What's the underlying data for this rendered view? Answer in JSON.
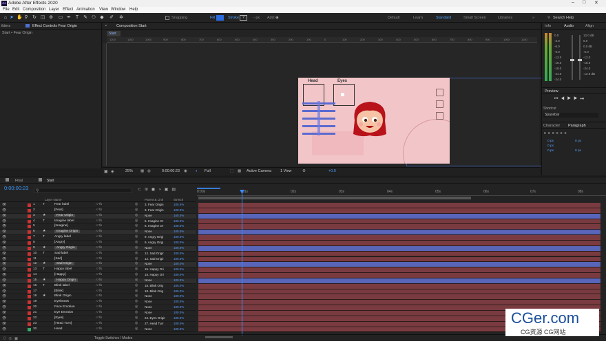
{
  "app": {
    "title": "Adobe After Effects 2020",
    "logo_text": "Ae"
  },
  "menu": [
    "File",
    "Edit",
    "Composition",
    "Layer",
    "Effect",
    "Animation",
    "View",
    "Window",
    "Help"
  ],
  "toolbar": {
    "snapping": "Snapping",
    "fill": "Fill",
    "stroke": "Stroke",
    "px": "- px",
    "add": "Add:"
  },
  "workspaces": [
    "Default",
    "Learn",
    "Standard",
    "Small Screen",
    "Libraries"
  ],
  "search_help": "Search Help",
  "left_panel": {
    "tabs": [
      "ilders",
      "Effect Controls Fear Origin"
    ],
    "breadcrumb": "Start • Fear Origin"
  },
  "comp_panel": {
    "tab": "Composition Start",
    "comp_tab": "Start",
    "ruler": [
      "1200",
      "1100",
      "1000",
      "900",
      "800",
      "700",
      "600",
      "500",
      "400",
      "300",
      "200",
      "100",
      "0",
      "100",
      "200",
      "300",
      "400",
      "500",
      "600",
      "700",
      "800",
      "900",
      "1000",
      "1100",
      "1200",
      "1300"
    ]
  },
  "viewer_bar": {
    "zoom": "25%",
    "time": "0:00:00:23",
    "res": "Full",
    "camera": "Active Camera",
    "view": "1 View",
    "offset": "+0.0"
  },
  "comp_art": {
    "head_label": "Head",
    "eyes_label": "Eyes"
  },
  "right_panel": {
    "tabs": [
      "Info",
      "Audio",
      "Align"
    ],
    "audio_levels": [
      "0.0",
      "-3.0",
      "-6.0",
      "-9.0",
      "-12.0",
      "-15.0",
      "-18.0",
      "-21.0",
      "-24.0"
    ],
    "audio_right": [
      "12.0 dB",
      "0.0 dB",
      "-12.0 dB"
    ],
    "preview": "Preview",
    "shortcut": "Shortcut",
    "shortcut_value": "Spacebar",
    "tabs2": [
      "Character",
      "Paragraph"
    ],
    "para_values": [
      "0 px",
      "0 px",
      "0 px",
      "0 px",
      "0 px"
    ]
  },
  "timeline": {
    "tabs": [
      "Final",
      "Start"
    ],
    "timecode": "0:00:00:23",
    "search_placeholder": "",
    "cols": {
      "layer_name": "Layer Name",
      "parent": "Parent & Link",
      "stretch": "Stretch"
    },
    "ticks": [
      "0:00s",
      "01s",
      "02s",
      "03s",
      "04s",
      "05s",
      "06s",
      "07s",
      "08s"
    ],
    "bottom": "Toggle Switches / Modes",
    "layers": [
      {
        "n": "1",
        "type": "T",
        "name": "Fear label",
        "parent": "3. Fear Origin",
        "stretch": "100.0%",
        "sel": false,
        "lbl": "#c33"
      },
      {
        "n": "2",
        "type": "",
        "name": "[Fear]",
        "parent": "3. Fear Origin",
        "stretch": "100.0%",
        "sel": false,
        "lbl": "#c33"
      },
      {
        "n": "3",
        "type": "★",
        "name": "Fear Origin",
        "parent": "None",
        "stretch": "100.0%",
        "sel": true,
        "lbl": "#c33"
      },
      {
        "n": "4",
        "type": "T",
        "name": "Imagine label",
        "parent": "6. Imagine Or",
        "stretch": "100.0%",
        "sel": false,
        "lbl": "#c33"
      },
      {
        "n": "5",
        "type": "",
        "name": "[Imagine]",
        "parent": "6. Imagine Or",
        "stretch": "100.0%",
        "sel": false,
        "lbl": "#c33"
      },
      {
        "n": "6",
        "type": "★",
        "name": "Imagine Origin",
        "parent": "None",
        "stretch": "100.0%",
        "sel": true,
        "lbl": "#c33"
      },
      {
        "n": "7",
        "type": "T",
        "name": "Angry label",
        "parent": "9. Angry Origi",
        "stretch": "100.0%",
        "sel": false,
        "lbl": "#c33"
      },
      {
        "n": "8",
        "type": "",
        "name": "[Angry]",
        "parent": "9. Angry Origi",
        "stretch": "100.0%",
        "sel": false,
        "lbl": "#c33"
      },
      {
        "n": "9",
        "type": "★",
        "name": "Angry Origin",
        "parent": "None",
        "stretch": "100.0%",
        "sel": true,
        "lbl": "#c33"
      },
      {
        "n": "10",
        "type": "T",
        "name": "Sad label",
        "parent": "12. Sad Origir",
        "stretch": "100.0%",
        "sel": false,
        "lbl": "#c33"
      },
      {
        "n": "11",
        "type": "",
        "name": "[Sad]",
        "parent": "12. Sad Origir",
        "stretch": "100.0%",
        "sel": false,
        "lbl": "#c33"
      },
      {
        "n": "12",
        "type": "★",
        "name": "Sad Origin",
        "parent": "None",
        "stretch": "100.0%",
        "sel": true,
        "lbl": "#c33"
      },
      {
        "n": "13",
        "type": "T",
        "name": "Happy label",
        "parent": "15. Happy Ori",
        "stretch": "100.0%",
        "sel": false,
        "lbl": "#c33"
      },
      {
        "n": "14",
        "type": "",
        "name": "[Happy]",
        "parent": "15. Happy Ori",
        "stretch": "100.0%",
        "sel": false,
        "lbl": "#c33"
      },
      {
        "n": "15",
        "type": "★",
        "name": "Happy Origin",
        "parent": "None",
        "stretch": "100.0%",
        "sel": true,
        "lbl": "#c33"
      },
      {
        "n": "16",
        "type": "T",
        "name": "Blink label",
        "parent": "18. Blink Orig",
        "stretch": "100.0%",
        "sel": false,
        "lbl": "#c33"
      },
      {
        "n": "17",
        "type": "",
        "name": "[Blink]",
        "parent": "18. Blink Orig",
        "stretch": "100.0%",
        "sel": false,
        "lbl": "#c33"
      },
      {
        "n": "18",
        "type": "★",
        "name": "Blink Origin",
        "parent": "None",
        "stretch": "100.0%",
        "sel": false,
        "lbl": "#c33"
      },
      {
        "n": "19",
        "type": "",
        "name": "Eyebrows",
        "parent": "None",
        "stretch": "100.0%",
        "sel": false,
        "lbl": "#c33"
      },
      {
        "n": "20",
        "type": "",
        "name": "Face Emotion",
        "parent": "None",
        "stretch": "100.0%",
        "sel": false,
        "lbl": "#c33"
      },
      {
        "n": "21",
        "type": "",
        "name": "Eye Emotion",
        "parent": "None",
        "stretch": "100.0%",
        "sel": false,
        "lbl": "#c33"
      },
      {
        "n": "22",
        "type": "",
        "name": "[Eyes]",
        "parent": "24. Eyes Origir",
        "stretch": "100.0%",
        "sel": false,
        "lbl": "#c33"
      },
      {
        "n": "23",
        "type": "",
        "name": "[Head Turn]",
        "parent": "27. Head Turr",
        "stretch": "100.0%",
        "sel": false,
        "lbl": "#c33"
      },
      {
        "n": "30",
        "type": "",
        "name": "Head",
        "parent": "None",
        "stretch": "100.0%",
        "sel": false,
        "lbl": "#3a6"
      }
    ]
  },
  "watermark": {
    "brand": "CGer.com",
    "sub": "CG资源  CG网站"
  },
  "colors": {
    "accent": "#2d8ceb",
    "timecode": "#3a9bff",
    "bar_red": "#7a3b40",
    "bar_blue": "#5865b8"
  }
}
